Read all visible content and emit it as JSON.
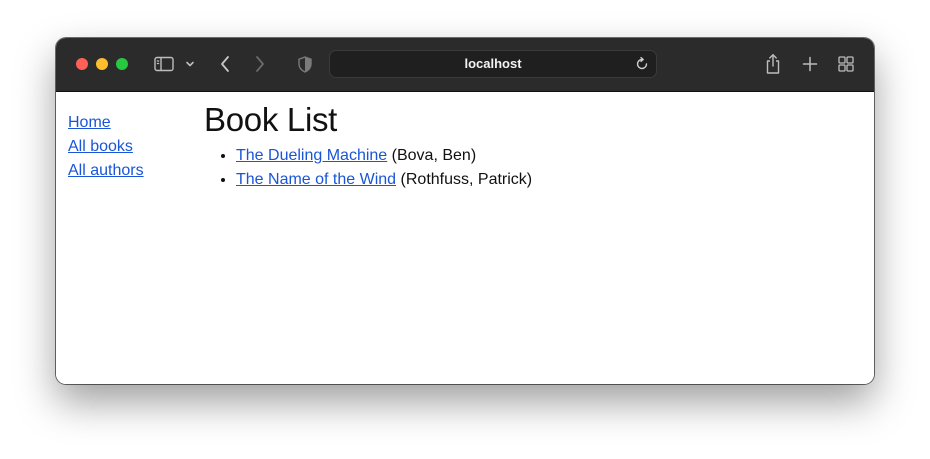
{
  "browser": {
    "address": "localhost",
    "icons": {
      "sidebar_toggle": "sidebar-icon",
      "chevron": "chevron-down-icon",
      "back": "back-arrow-icon",
      "forward": "forward-arrow-icon",
      "privacy": "shield-icon",
      "reload": "reload-icon",
      "share": "share-icon",
      "new_tab": "plus-icon",
      "tab_overview": "grid-icon"
    }
  },
  "nav": {
    "items": [
      {
        "label": "Home"
      },
      {
        "label": "All books"
      },
      {
        "label": "All authors"
      }
    ]
  },
  "main": {
    "title": "Book List",
    "books": [
      {
        "title": "The Dueling Machine",
        "author": "(Bova, Ben)"
      },
      {
        "title": "The Name of the Wind",
        "author": "(Rothfuss, Patrick)"
      }
    ]
  },
  "colors": {
    "link": "#1a55d8",
    "titlebar": "#2b2b2b",
    "close": "#fe5f57",
    "minimize": "#febc2e",
    "maximize": "#28c840"
  }
}
